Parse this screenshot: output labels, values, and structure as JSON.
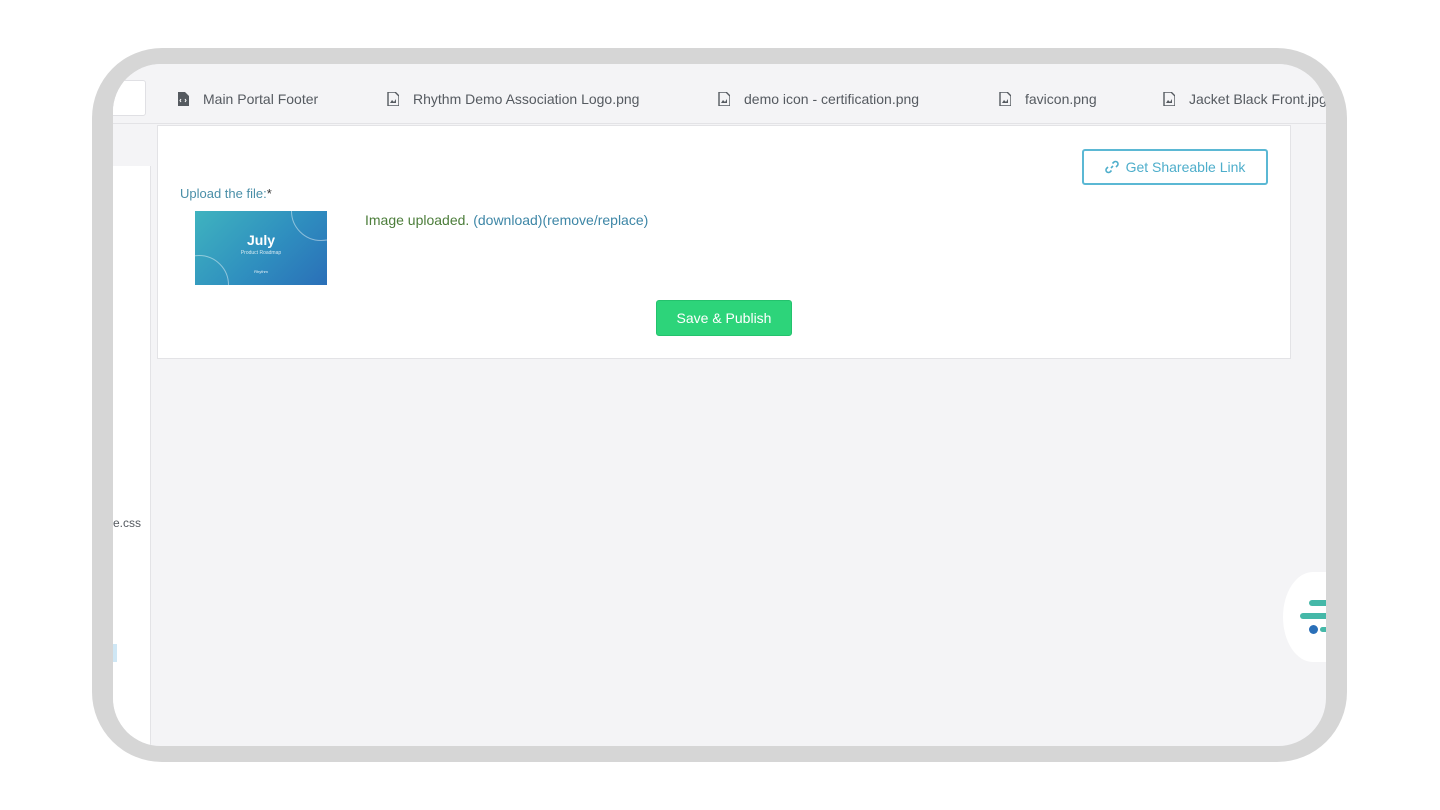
{
  "tabs": [
    {
      "label": "Main Portal Footer",
      "icon": "code-file-icon"
    },
    {
      "label": "Rhythm Demo Association Logo.png",
      "icon": "image-file-icon"
    },
    {
      "label": "demo icon - certification.png",
      "icon": "image-file-icon"
    },
    {
      "label": "favicon.png",
      "icon": "image-file-icon"
    },
    {
      "label": "Jacket Black Front.jpg",
      "icon": "image-file-icon"
    }
  ],
  "sidebar": {
    "file_label": "e.css"
  },
  "card": {
    "share_button": {
      "label": "Get Shareable Link",
      "icon": "link-icon"
    },
    "upload_label": "Upload the file:",
    "required_mark": "*",
    "thumbnail": {
      "title": "July",
      "subtitle": "Product Roadmap",
      "brand": "Rhythm"
    },
    "status_text": "Image uploaded. ",
    "download_link": "(download)",
    "remove_link": "(remove/replace)",
    "publish_button": "Save & Publish"
  },
  "colors": {
    "accent": "#4eaecb",
    "publish": "#2dd47a",
    "status_green": "#4c7d3a",
    "link": "#3d86a6"
  }
}
